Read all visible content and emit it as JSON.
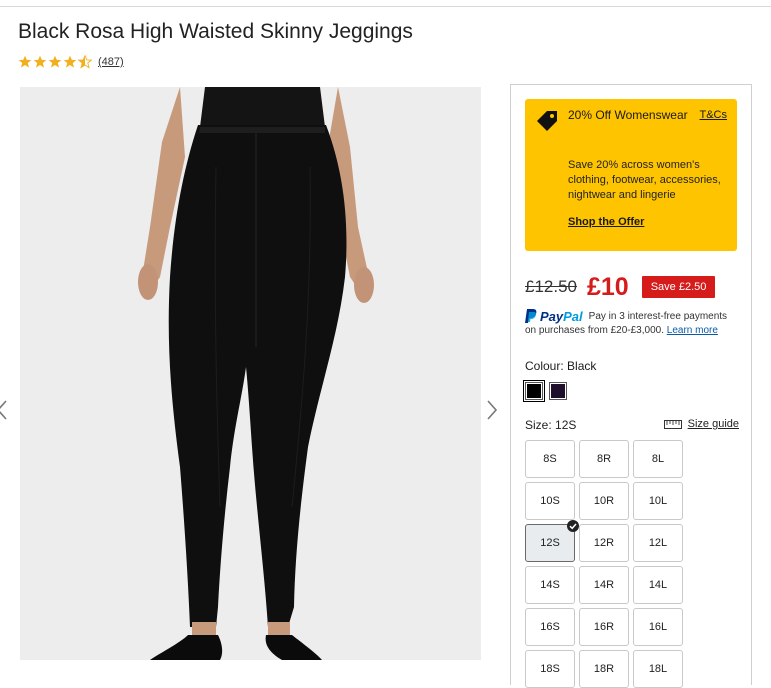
{
  "product": {
    "title": "Black Rosa High Waisted Skinny Jeggings",
    "rating": 4.5,
    "review_count": "(487)"
  },
  "gallery": {
    "prev_icon": "chevron-left-icon",
    "next_icon": "chevron-right-icon"
  },
  "offer": {
    "icon": "tag-icon",
    "title": "20% Off Womenswear",
    "tcs": "T&Cs",
    "description": "Save 20% across women's clothing, footwear, accessories, nightwear and lingerie",
    "link": "Shop the Offer",
    "color": "#ffc400"
  },
  "price": {
    "old": "£12.50",
    "current": "£10",
    "save": "Save £2.50",
    "accent": "#d61b1b"
  },
  "paypal": {
    "logo_a": "Pay",
    "logo_b": "Pal",
    "line1": "Pay in 3 interest-free payments",
    "line2": "on purchases from £20-£3,000.",
    "learn_more": "Learn more"
  },
  "colour": {
    "label": "Colour:",
    "value": "Black",
    "swatches": [
      {
        "name": "Black",
        "color": "#000000",
        "selected": true
      },
      {
        "name": "Purple",
        "color": "#1e0f2b",
        "selected": false
      }
    ]
  },
  "size": {
    "label": "Size:",
    "value": "12S",
    "guide": "Size guide",
    "guide_icon": "ruler-icon",
    "options": [
      "8S",
      "8R",
      "8L",
      "10S",
      "10R",
      "10L",
      "12S",
      "12R",
      "12L",
      "14S",
      "14R",
      "14L",
      "16S",
      "16R",
      "16L",
      "18S",
      "18R",
      "18L"
    ],
    "selected": "12S"
  }
}
